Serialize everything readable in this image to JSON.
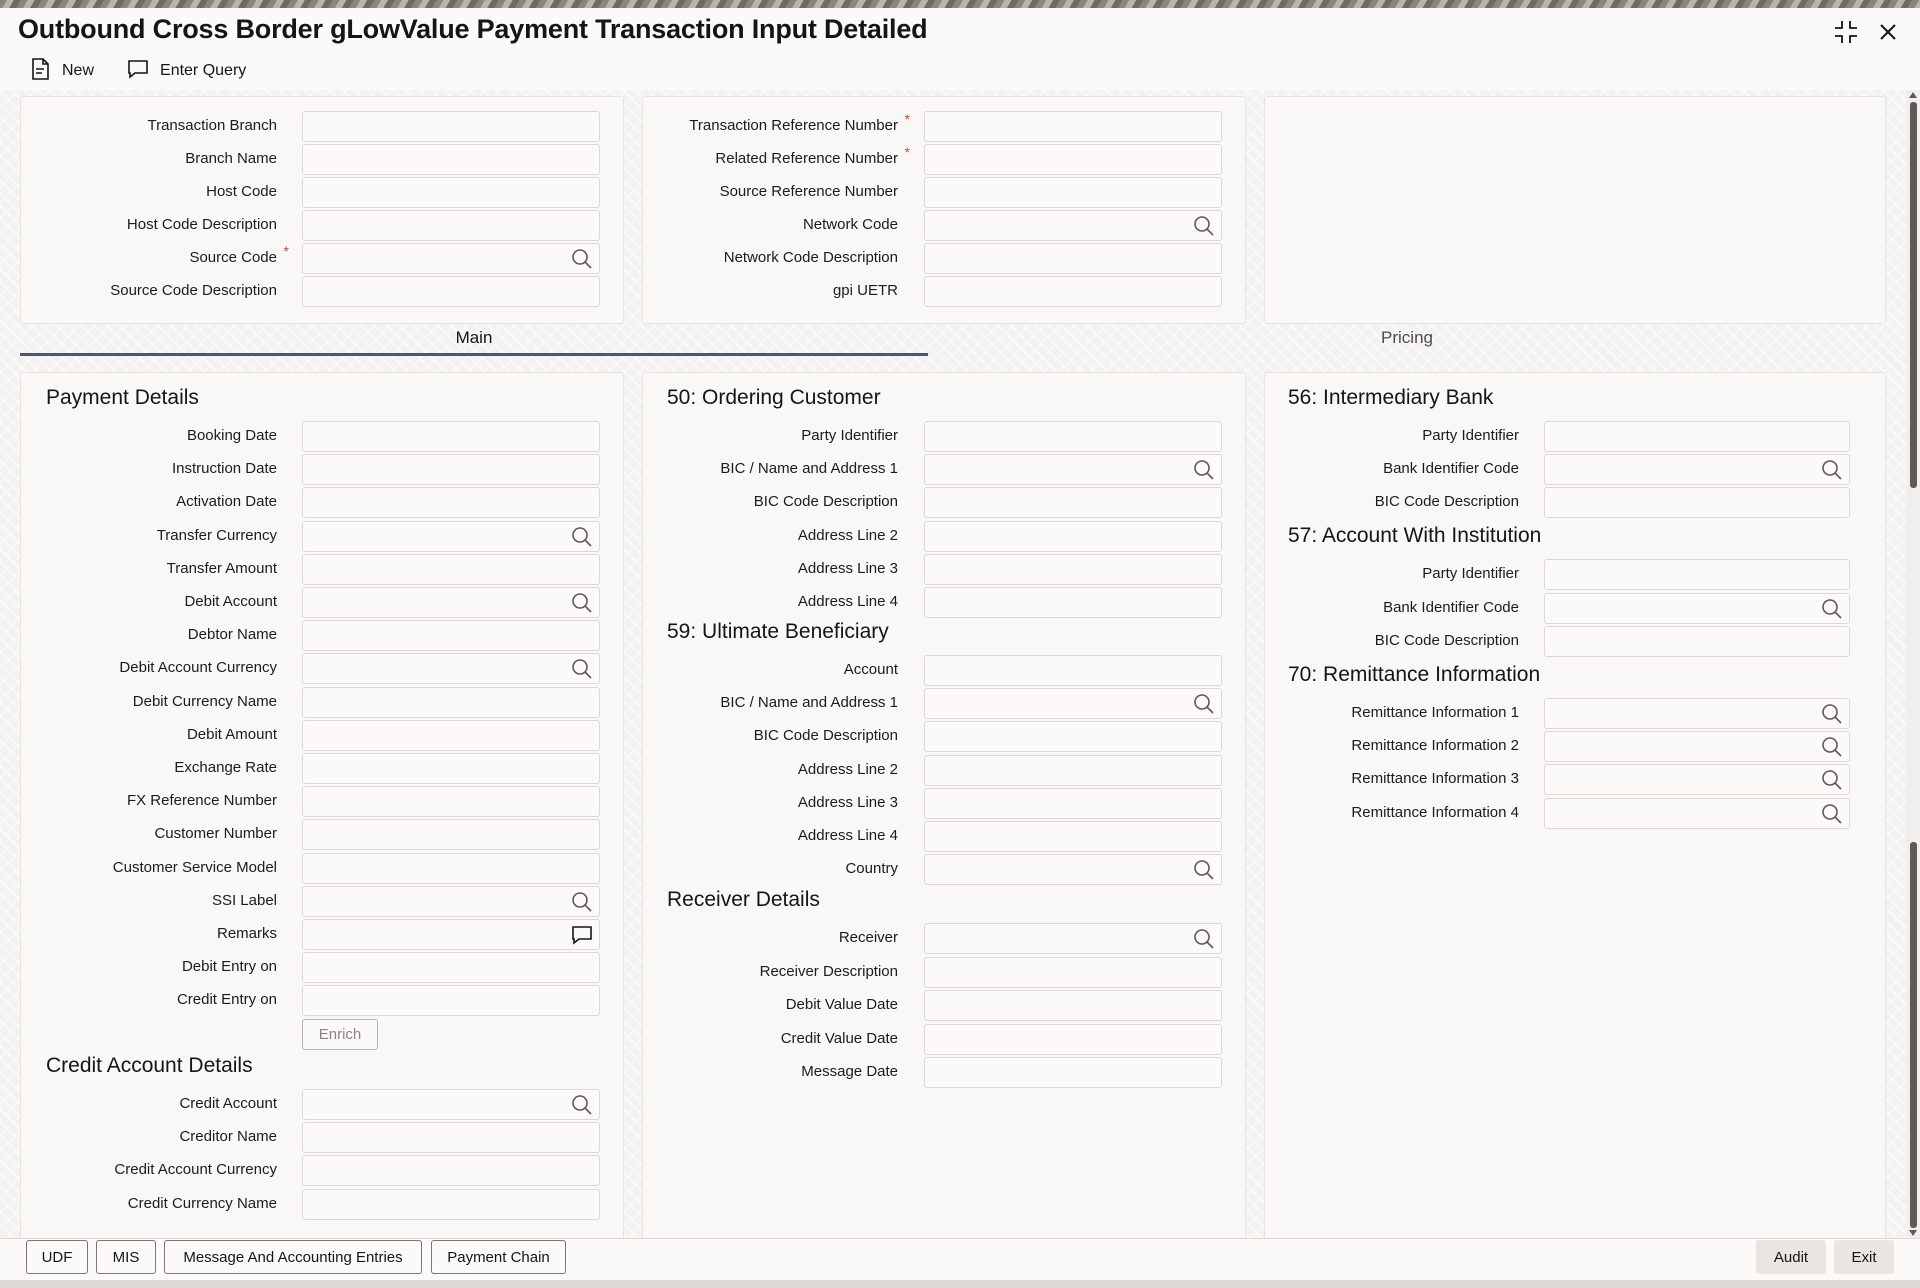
{
  "window": {
    "title": "Outbound Cross Border gLowValue Payment Transaction Input Detailed"
  },
  "toolbar": {
    "new_label": "New",
    "enter_query_label": "Enter Query"
  },
  "header_left": {
    "fields": [
      {
        "label": "Transaction Branch",
        "value": "",
        "required": false,
        "lookup": false
      },
      {
        "label": "Branch Name",
        "value": "",
        "required": false,
        "lookup": false
      },
      {
        "label": "Host Code",
        "value": "",
        "required": false,
        "lookup": false
      },
      {
        "label": "Host Code Description",
        "value": "",
        "required": false,
        "lookup": false
      },
      {
        "label": "Source Code",
        "value": "",
        "required": true,
        "lookup": true
      },
      {
        "label": "Source Code Description",
        "value": "",
        "required": false,
        "lookup": false
      }
    ]
  },
  "header_mid": {
    "fields": [
      {
        "label": "Transaction Reference Number",
        "value": "",
        "required": true,
        "lookup": false
      },
      {
        "label": "Related Reference Number",
        "value": "",
        "required": true,
        "lookup": false
      },
      {
        "label": "Source Reference Number",
        "value": "",
        "required": false,
        "lookup": false
      },
      {
        "label": "Network Code",
        "value": "",
        "required": false,
        "lookup": true
      },
      {
        "label": "Network Code Description",
        "value": "",
        "required": false,
        "lookup": false
      },
      {
        "label": "gpi UETR",
        "value": "",
        "required": false,
        "lookup": false
      }
    ]
  },
  "tabs": [
    {
      "label": "Main",
      "active": true
    },
    {
      "label": "Pricing",
      "active": false
    }
  ],
  "payment_details": {
    "title": "Payment Details",
    "fields": [
      {
        "label": "Booking Date",
        "value": "",
        "icon": ""
      },
      {
        "label": "Instruction Date",
        "value": "",
        "icon": ""
      },
      {
        "label": "Activation Date",
        "value": "",
        "icon": ""
      },
      {
        "label": "Transfer Currency",
        "value": "",
        "icon": "search-icon"
      },
      {
        "label": "Transfer Amount",
        "value": "",
        "icon": ""
      },
      {
        "label": "Debit Account",
        "value": "",
        "icon": "search-icon"
      },
      {
        "label": "Debtor Name",
        "value": "",
        "icon": ""
      },
      {
        "label": "Debit Account Currency",
        "value": "",
        "icon": "search-icon"
      },
      {
        "label": "Debit Currency Name",
        "value": "",
        "icon": ""
      },
      {
        "label": "Debit Amount",
        "value": "",
        "icon": ""
      },
      {
        "label": "Exchange Rate",
        "value": "",
        "icon": ""
      },
      {
        "label": "FX Reference Number",
        "value": "",
        "icon": ""
      },
      {
        "label": "Customer Number",
        "value": "",
        "icon": ""
      },
      {
        "label": "Customer Service Model",
        "value": "",
        "icon": ""
      },
      {
        "label": "SSI Label",
        "value": "",
        "icon": "search-icon"
      },
      {
        "label": "Remarks",
        "value": "",
        "icon": "comment-icon"
      },
      {
        "label": "Debit Entry on",
        "value": "",
        "icon": ""
      },
      {
        "label": "Credit Entry on",
        "value": "",
        "icon": ""
      }
    ],
    "enrich_label": "Enrich"
  },
  "credit_account_details": {
    "title": "Credit Account Details",
    "fields": [
      {
        "label": "Credit Account",
        "value": "",
        "icon": "search-icon"
      },
      {
        "label": "Creditor Name",
        "value": "",
        "icon": ""
      },
      {
        "label": "Credit Account Currency",
        "value": "",
        "icon": ""
      },
      {
        "label": "Credit Currency Name",
        "value": "",
        "icon": ""
      }
    ]
  },
  "ordering_customer": {
    "title": "50: Ordering Customer",
    "fields": [
      {
        "label": "Party Identifier",
        "value": "",
        "icon": ""
      },
      {
        "label": "BIC / Name and Address 1",
        "value": "",
        "icon": "search-icon"
      },
      {
        "label": "BIC Code Description",
        "value": "",
        "icon": ""
      },
      {
        "label": "Address Line 2",
        "value": "",
        "icon": ""
      },
      {
        "label": "Address Line 3",
        "value": "",
        "icon": ""
      },
      {
        "label": "Address Line 4",
        "value": "",
        "icon": ""
      }
    ]
  },
  "ultimate_beneficiary": {
    "title": "59: Ultimate Beneficiary",
    "fields": [
      {
        "label": "Account",
        "value": "",
        "icon": ""
      },
      {
        "label": "BIC / Name and Address 1",
        "value": "",
        "icon": "search-icon"
      },
      {
        "label": "BIC Code Description",
        "value": "",
        "icon": ""
      },
      {
        "label": "Address Line 2",
        "value": "",
        "icon": ""
      },
      {
        "label": "Address Line 3",
        "value": "",
        "icon": ""
      },
      {
        "label": "Address Line 4",
        "value": "",
        "icon": ""
      },
      {
        "label": "Country",
        "value": "",
        "icon": "search-icon"
      }
    ]
  },
  "receiver_details": {
    "title": "Receiver Details",
    "fields": [
      {
        "label": "Receiver",
        "value": "",
        "icon": "search-icon"
      },
      {
        "label": "Receiver Description",
        "value": "",
        "icon": ""
      },
      {
        "label": "Debit Value Date",
        "value": "",
        "icon": ""
      },
      {
        "label": "Credit Value Date",
        "value": "",
        "icon": ""
      },
      {
        "label": "Message Date",
        "value": "",
        "icon": ""
      }
    ]
  },
  "intermediary_bank": {
    "title": "56: Intermediary Bank",
    "fields": [
      {
        "label": "Party Identifier",
        "value": "",
        "icon": ""
      },
      {
        "label": "Bank Identifier Code",
        "value": "",
        "icon": "search-icon"
      },
      {
        "label": "BIC Code Description",
        "value": "",
        "icon": ""
      }
    ]
  },
  "account_with_institution": {
    "title": "57: Account With Institution",
    "fields": [
      {
        "label": "Party Identifier",
        "value": "",
        "icon": ""
      },
      {
        "label": "Bank Identifier Code",
        "value": "",
        "icon": "search-icon"
      },
      {
        "label": "BIC Code Description",
        "value": "",
        "icon": ""
      }
    ]
  },
  "remittance_information": {
    "title": "70: Remittance Information",
    "fields": [
      {
        "label": "Remittance Information 1",
        "value": "",
        "icon": "search-icon"
      },
      {
        "label": "Remittance Information 2",
        "value": "",
        "icon": "search-icon"
      },
      {
        "label": "Remittance Information 3",
        "value": "",
        "icon": "search-icon"
      },
      {
        "label": "Remittance Information 4",
        "value": "",
        "icon": "search-icon"
      }
    ]
  },
  "footer": {
    "left_buttons": [
      "UDF",
      "MIS",
      "Message And Accounting Entries",
      "Payment Chain"
    ],
    "right_buttons": [
      "Audit",
      "Exit"
    ]
  },
  "colors": {
    "required_marker": "#c74634",
    "active_tab_underline": "#425a80"
  }
}
